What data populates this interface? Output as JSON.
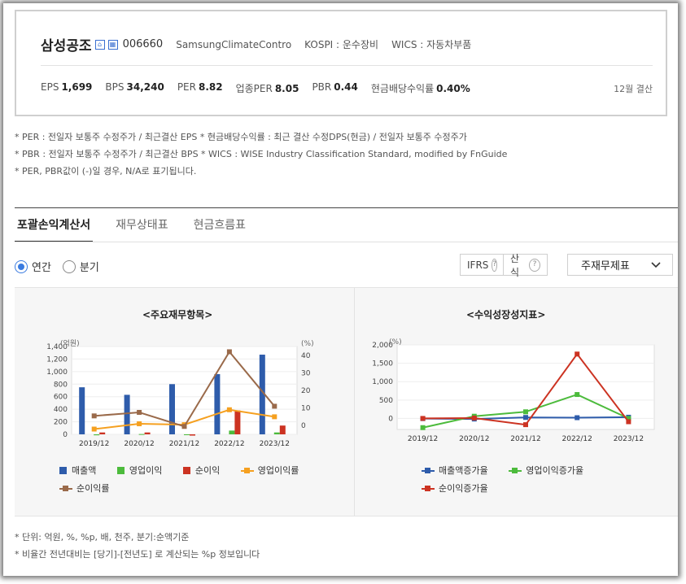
{
  "company": {
    "name": "삼성공조",
    "code": "006660",
    "english_name": "SamsungClimateContro",
    "market": "KOSPI : 운수장비",
    "wics": "WICS : 자동차부품"
  },
  "metrics": [
    {
      "label": "EPS",
      "value": "1,699"
    },
    {
      "label": "BPS",
      "value": "34,240"
    },
    {
      "label": "PER",
      "value": "8.82"
    },
    {
      "label": "업종PER",
      "value": "8.05"
    },
    {
      "label": "PBR",
      "value": "0.44"
    },
    {
      "label": "현금배당수익률",
      "value": "0.40%"
    }
  ],
  "settlement": "12월 결산",
  "notes": [
    "* PER : 전일자 보통주 수정주가 / 최근결산 EPS * 현금배당수익률 : 최근 결산 수정DPS(현금) / 전일자 보통주 수정주가",
    "* PBR : 전일자 보통주 수정주가 / 최근결산 BPS * WICS : WISE Industry Classification Standard, modified by FnGuide",
    "* PER, PBR값이 (-)일 경우, N/A로 표기됩니다."
  ],
  "tabs": [
    "포괄손익계산서",
    "재무상태표",
    "현금흐름표"
  ],
  "period": {
    "annual": "연간",
    "quarter": "분기"
  },
  "options": {
    "ifrs": "IFRS",
    "calc": "산식",
    "help_glyph": "?",
    "statement_select": "주재무제표"
  },
  "colors": {
    "revenue": "#2e5cab",
    "op_profit": "#4cbb3c",
    "net_profit": "#cc3322",
    "op_margin": "#f5a020",
    "net_margin": "#9a6a4a"
  },
  "chart_data": [
    {
      "type": "bar",
      "title": "<주요재무항목>",
      "categories": [
        "2019/12",
        "2020/12",
        "2021/12",
        "2022/12",
        "2023/12"
      ],
      "ylabel_left": "(억원)",
      "ylabel_right": "(%)",
      "ylim_left": [
        0,
        1400
      ],
      "yticks_left": [
        "0",
        "200",
        "400",
        "600",
        "800",
        "1,000",
        "1,200",
        "1,400"
      ],
      "ylim_right": [
        -5,
        45
      ],
      "yticks_right": [
        "0",
        "10",
        "20",
        "30",
        "40"
      ],
      "grid": true,
      "legend_position": "bottom",
      "series": [
        {
          "name": "매출액",
          "kind": "bar",
          "axis": "left",
          "values": [
            750,
            630,
            800,
            960,
            1270
          ]
        },
        {
          "name": "영업이익",
          "kind": "bar",
          "axis": "left",
          "values": [
            -15,
            5,
            -10,
            60,
            30
          ]
        },
        {
          "name": "순이익",
          "kind": "bar",
          "axis": "left",
          "values": [
            30,
            30,
            -20,
            380,
            140
          ]
        },
        {
          "name": "영업이익률",
          "kind": "line",
          "axis": "right",
          "values": [
            -2,
            1,
            0.5,
            9,
            5
          ]
        },
        {
          "name": "순이익률",
          "kind": "line",
          "axis": "right",
          "values": [
            5.5,
            7.5,
            -0.5,
            42,
            11
          ]
        }
      ]
    },
    {
      "type": "line",
      "title": "<수익성장성지표>",
      "categories": [
        "2019/12",
        "2020/12",
        "2021/12",
        "2022/12",
        "2023/12"
      ],
      "ylabel": "(%)",
      "ylim": [
        -300,
        2000
      ],
      "yticks": [
        "0",
        "500",
        "1,000",
        "1,500",
        "2,000"
      ],
      "grid": true,
      "legend_position": "bottom",
      "series": [
        {
          "name": "매출액증가율",
          "values": [
            -5,
            -16,
            27,
            20,
            33
          ]
        },
        {
          "name": "영업이익증가율",
          "values": [
            -250,
            60,
            180,
            650,
            0
          ]
        },
        {
          "name": "순이익증가율",
          "values": [
            0,
            10,
            -170,
            1750,
            -90
          ]
        }
      ]
    }
  ],
  "footer": [
    "* 단위: 억원, %, %p, 배, 천주, 분기:순액기준",
    "* 비율간 전년대비는 [당기]-[전년도] 로 계산되는 %p 정보입니다"
  ]
}
